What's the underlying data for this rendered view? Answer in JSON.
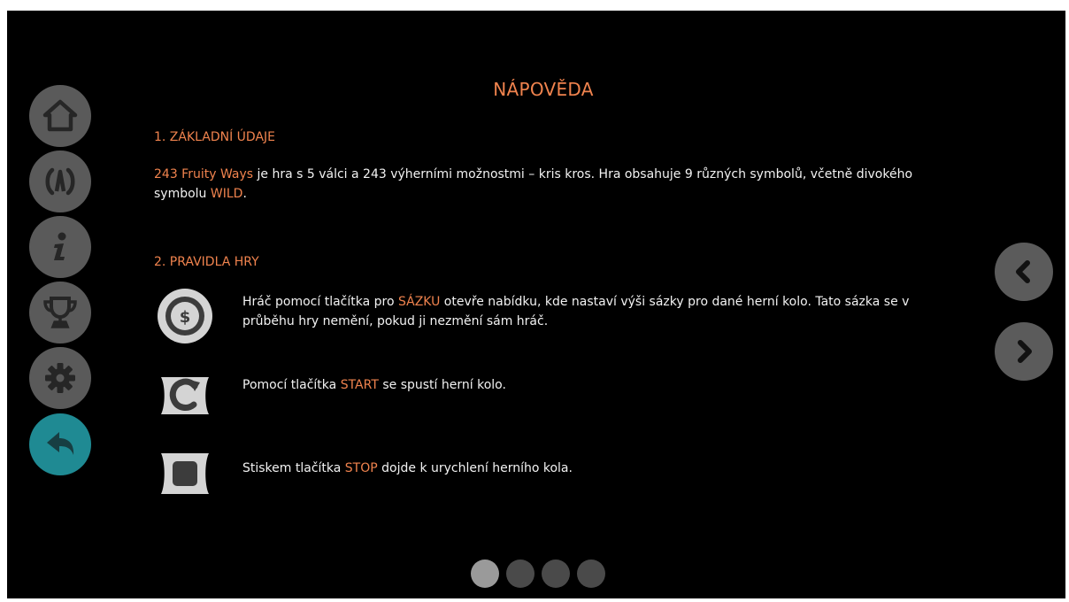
{
  "sidebar": {
    "items": [
      {
        "name": "home",
        "icon": "home-icon"
      },
      {
        "name": "paytable",
        "icon": "paytable-icon"
      },
      {
        "name": "info",
        "icon": "info-icon"
      },
      {
        "name": "trophy",
        "icon": "trophy-icon"
      },
      {
        "name": "settings",
        "icon": "gear-icon"
      },
      {
        "name": "back",
        "icon": "back-arrow-icon",
        "active": true
      }
    ],
    "button_color": "#5a5a5a",
    "active_color": "#1f8a93"
  },
  "help": {
    "title": "NÁPOVĚDA",
    "section1": {
      "heading": "1. ZÁKLADNÍ ÚDAJE",
      "game_name": "243 Fruity Ways",
      "text_a": " je hra s 5 válci a 243 výherními možnostmi – kris kros. Hra obsahuje 9 různých symbolů, včetně divokého symbolu ",
      "wild": "WILD",
      "text_end": "."
    },
    "section2": {
      "heading": "2. PRAVIDLA HRY",
      "rules": [
        {
          "icon": "bet-coin-icon",
          "pre": "Hráč pomocí tlačítka pro ",
          "keyword": "SÁZKU",
          "post": " otevře nabídku, kde nastaví výši sázky pro dané herní kolo. Tato sázka se v průběhu hry nemění, pokud ji nezmění sám hráč."
        },
        {
          "icon": "spin-start-icon",
          "pre": "Pomocí tlačítka ",
          "keyword": "START",
          "post": " se spustí herní kolo."
        },
        {
          "icon": "stop-icon",
          "pre": "Stiskem tlačítka ",
          "keyword": "STOP",
          "post": " dojde k urychlení herního kola."
        }
      ]
    }
  },
  "navigation": {
    "prev_icon": "chevron-left-icon",
    "next_icon": "chevron-right-icon"
  },
  "pagination": {
    "total": 4,
    "current": 1
  },
  "colors": {
    "accent": "#f0834e",
    "text": "#f2f2f2",
    "background": "#000000"
  }
}
